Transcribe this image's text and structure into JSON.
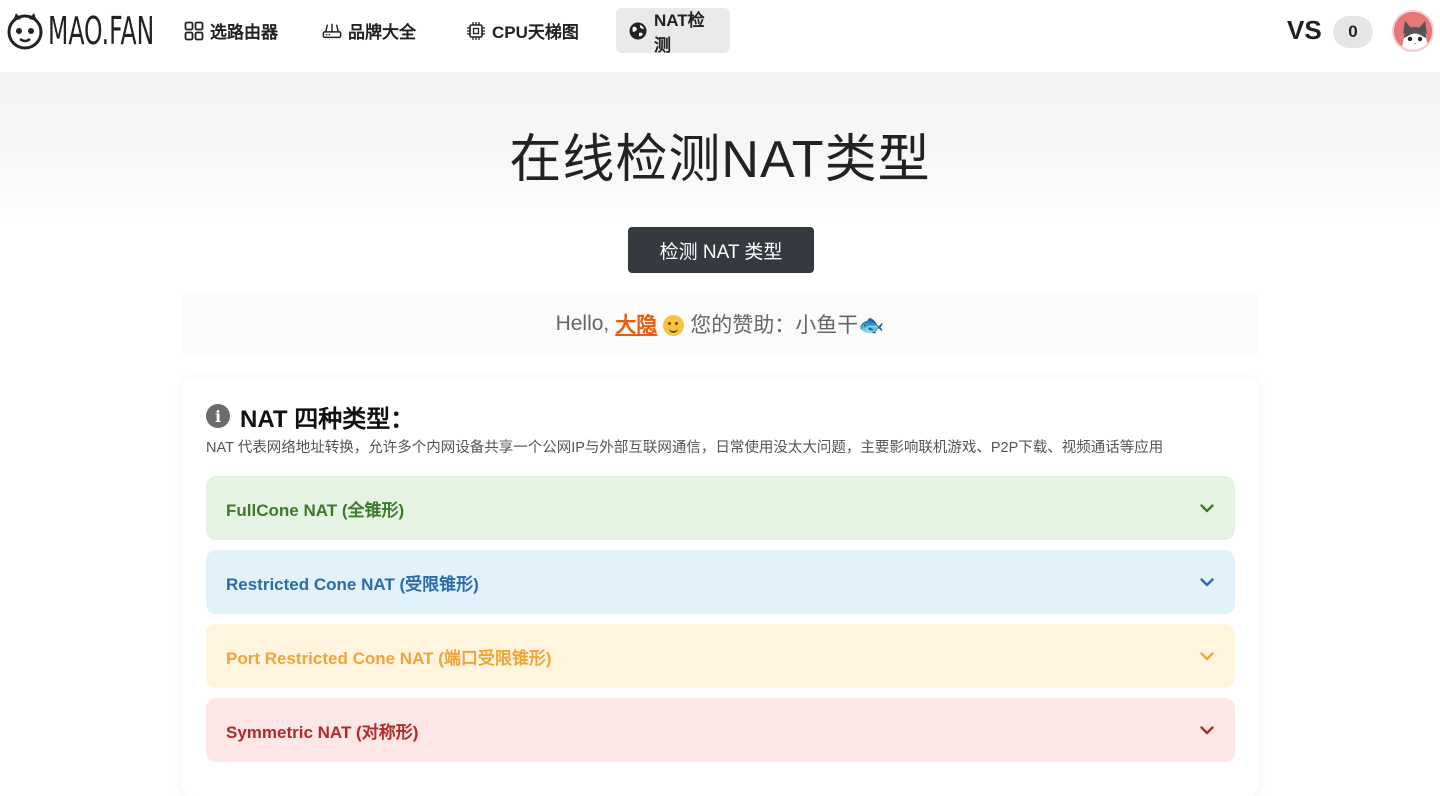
{
  "header": {
    "logo_text": "MAO.FAN",
    "nav": [
      {
        "label": "选路由器",
        "icon": "grid-icon"
      },
      {
        "label": "品牌大全",
        "icon": "router-icon"
      },
      {
        "label": "CPU天梯图",
        "icon": "cpu-icon"
      },
      {
        "label": "NAT检测",
        "icon": "globe-icon",
        "active": true
      }
    ],
    "vs_label": "VS",
    "vs_count": "0"
  },
  "hero": {
    "title": "在线检测NAT类型",
    "button_label": "检测 NAT 类型"
  },
  "greeting": {
    "hello": "Hello,",
    "name": "大隐",
    "sponsor_text": "您的赞助：小鱼干🐟"
  },
  "nat_types": {
    "title": "NAT 四种类型：",
    "description": "NAT 代表网络地址转换，允许多个内网设备共享一个公网IP与外部互联网通信，日常使用没太大问题，主要影响联机游戏、P2P下载、视频通话等应用",
    "items": [
      {
        "label": "FullCone NAT (全锥形)",
        "color": "#3d7a2a"
      },
      {
        "label": "Restricted Cone NAT (受限锥形)",
        "color": "#2b6ca8"
      },
      {
        "label": "Port Restricted Cone NAT (端口受限锥形)",
        "color": "#f0a53a"
      },
      {
        "label": "Symmetric NAT (对称形)",
        "color": "#b02a2a"
      }
    ]
  }
}
